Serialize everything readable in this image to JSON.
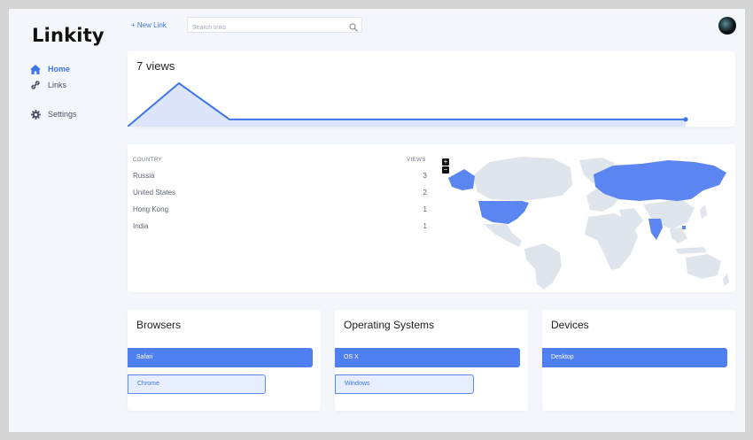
{
  "app": {
    "logo": "Linkity"
  },
  "sidebar": {
    "items": [
      {
        "label": "Home",
        "icon": "home-icon",
        "active": true
      },
      {
        "label": "Links",
        "icon": "link-icon",
        "active": false
      },
      {
        "label": "Settings",
        "icon": "gear-icon",
        "active": false
      }
    ]
  },
  "header": {
    "new_link_label": "+ New Link",
    "search_placeholder": "Search links",
    "search_icon": "search-icon",
    "avatar_icon": "avatar"
  },
  "views": {
    "title": "7 views",
    "chart_data": {
      "type": "area",
      "values": [
        0,
        6,
        1,
        1,
        1,
        1,
        1,
        1,
        1,
        1,
        1,
        1,
        1
      ]
    }
  },
  "geo": {
    "country_header": "COUNTRY",
    "views_header": "VIEWS",
    "rows": [
      {
        "country": "Russia",
        "views": "3"
      },
      {
        "country": "United States",
        "views": "2"
      },
      {
        "country": "Hong Kong",
        "views": "1"
      },
      {
        "country": "India",
        "views": "1"
      }
    ],
    "zoom_in": "+",
    "zoom_out": "−",
    "highlight_color": "#5b86f1",
    "land_color": "#dfe5ec"
  },
  "browsers": {
    "title": "Browsers",
    "items": [
      {
        "label": "Safari",
        "share": 1.0
      },
      {
        "label": "Chrome",
        "share": 0.75
      }
    ]
  },
  "os": {
    "title": "Operating Systems",
    "items": [
      {
        "label": "OS X",
        "share": 1.0
      },
      {
        "label": "Windows",
        "share": 0.75
      }
    ]
  },
  "devices": {
    "title": "Devices",
    "items": [
      {
        "label": "Desktop",
        "share": 1.0
      }
    ]
  },
  "colors": {
    "accent": "#3e75ea",
    "bar": "#4f7ff0",
    "bar_light": "#e6eeff",
    "chart_fill": "#dce5fb"
  }
}
